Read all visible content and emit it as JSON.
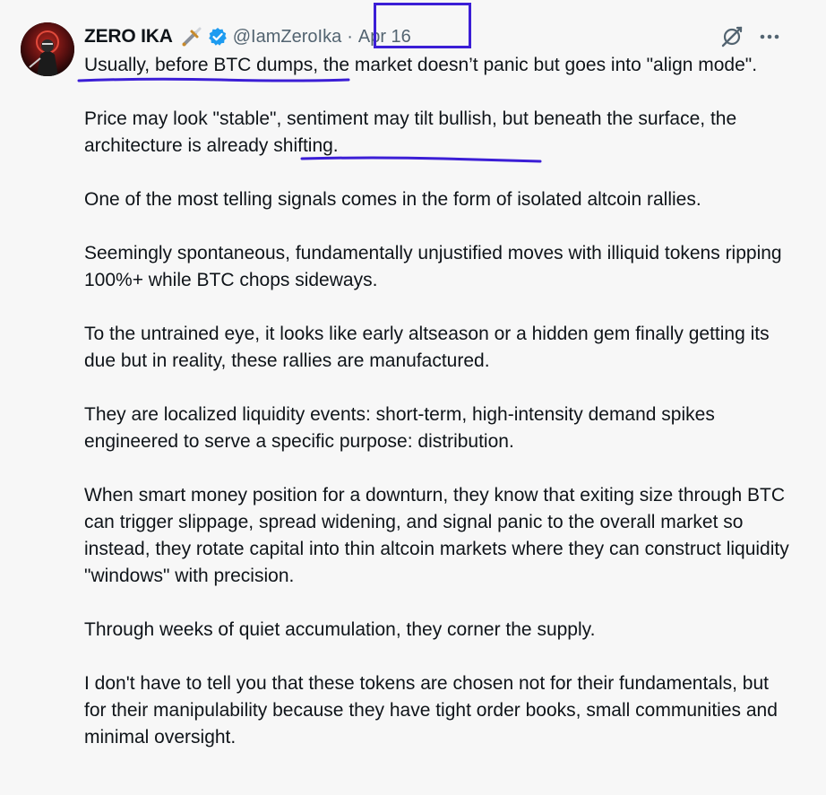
{
  "author": {
    "display_name": "ZERO IKA",
    "emoji": "🗡",
    "handle": "@IamZeroIka",
    "separator": "·",
    "date": "Apr 16"
  },
  "icons": {
    "verified": "verified-badge-icon",
    "grok": "grok-icon",
    "more": "more-options-icon"
  },
  "colors": {
    "verified": "#1d9bf0",
    "annotation": "#3b1ed6",
    "text": "#0f1419",
    "muted": "#536471"
  },
  "paragraphs": [
    {
      "before": "",
      "highlight": "Usually, before BTC dumps,",
      "after": " the market doesn’t panic but goes into \"align mode\"."
    },
    {
      "before": "Price may look \"stable\", ",
      "highlight": "sentiment may tilt bullish",
      "after": ", but beneath the surface, the architecture is already shifting."
    },
    {
      "before": "One of the most telling signals comes in the form of isolated altcoin rallies.",
      "highlight": "",
      "after": ""
    },
    {
      "before": "Seemingly spontaneous, fundamentally unjustified moves with illiquid tokens ripping 100%+ while BTC chops sideways.",
      "highlight": "",
      "after": ""
    },
    {
      "before": "To the untrained eye, it looks like early altseason or a hidden gem finally getting its due but in reality, these rallies are manufactured.",
      "highlight": "",
      "after": ""
    },
    {
      "before": "They are localized liquidity events: short-term, high-intensity demand spikes engineered to serve a specific purpose: distribution.",
      "highlight": "",
      "after": ""
    },
    {
      "before": "When smart money position for a downturn, they know that exiting size through BTC can trigger slippage, spread widening, and signal panic to the overall market so instead, they rotate capital into thin altcoin markets where they can construct liquidity \"windows\" with precision.",
      "highlight": "",
      "after": ""
    },
    {
      "before": "Through weeks of quiet accumulation, they corner the supply.",
      "highlight": "",
      "after": ""
    },
    {
      "before": "I don't have to tell you that these tokens are chosen not for their fundamentals, but for their manipulability because they have tight order books, small communities and minimal oversight.",
      "highlight": "",
      "after": ""
    }
  ]
}
